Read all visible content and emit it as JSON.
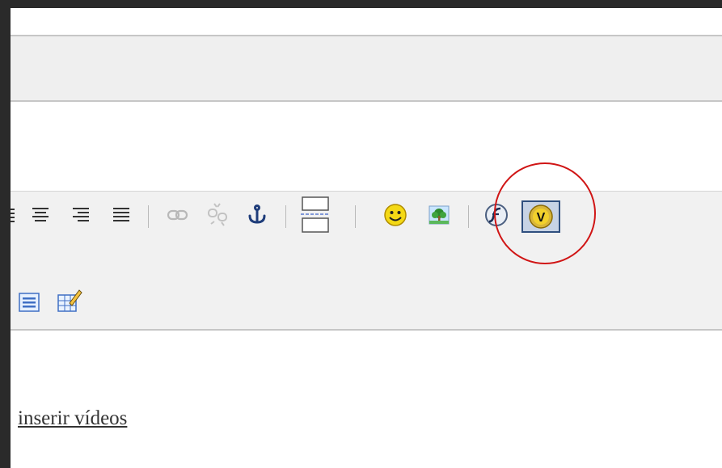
{
  "editor": {
    "toolbar_row1": [
      {
        "name": "align-center-icon"
      },
      {
        "name": "align-right-icon"
      },
      {
        "name": "align-justify-icon"
      },
      {
        "name": "link-icon"
      },
      {
        "name": "unlink-icon"
      },
      {
        "name": "anchor-icon"
      },
      {
        "name": "page-break-icon"
      },
      {
        "name": "smiley-icon"
      },
      {
        "name": "image-icon"
      },
      {
        "name": "flash-icon"
      },
      {
        "name": "video-icon"
      }
    ],
    "toolbar_row2": [
      {
        "name": "form-list-icon"
      },
      {
        "name": "table-edit-icon"
      }
    ],
    "content_link": "inserir vídeos"
  },
  "colors": {
    "highlight_circle": "#d01515",
    "selected_button_border": "#2f4f7f",
    "selected_button_bg": "#c7d3e5"
  }
}
